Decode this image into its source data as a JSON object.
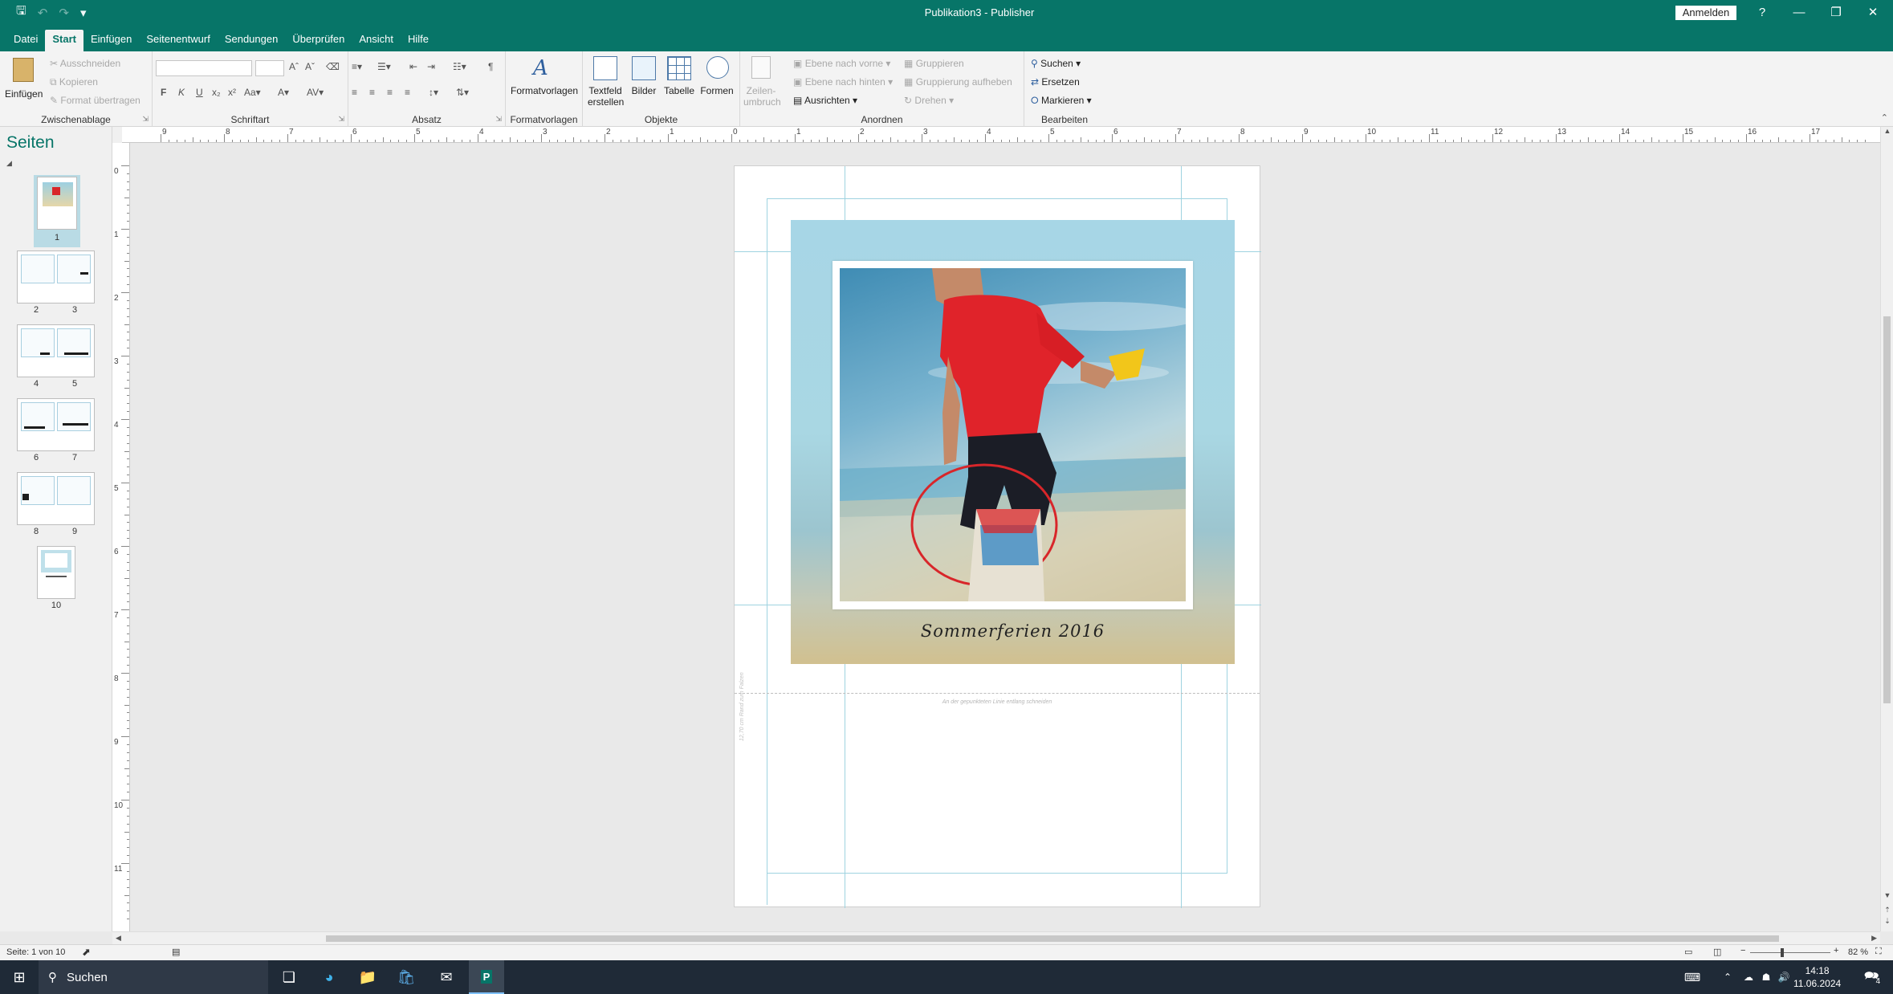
{
  "titlebar": {
    "title": "Publikation3  -  Publisher",
    "signin": "Anmelden",
    "help": "?"
  },
  "menu": {
    "tabs": [
      "Datei",
      "Start",
      "Einfügen",
      "Seitenentwurf",
      "Sendungen",
      "Überprüfen",
      "Ansicht",
      "Hilfe"
    ],
    "active": "Start"
  },
  "ribbon": {
    "clipboard": {
      "paste": "Einfügen",
      "cut": "Ausschneiden",
      "copy": "Kopieren",
      "format_painter": "Format übertragen",
      "label": "Zwischenablage"
    },
    "font": {
      "label": "Schriftart",
      "bold": "F",
      "italic": "K",
      "underline": "U"
    },
    "paragraph": {
      "label": "Absatz"
    },
    "styles": {
      "button": "Formatvorlagen",
      "label": "Formatvorlagen"
    },
    "objects": {
      "textbox_line1": "Textfeld",
      "textbox_line2": "erstellen",
      "pictures": "Bilder",
      "table": "Tabelle",
      "shapes": "Formen",
      "label": "Objekte"
    },
    "arrange": {
      "wrap_line1": "Zeilen-",
      "wrap_line2": "umbruch",
      "bring_forward": "Ebene nach vorne",
      "send_backward": "Ebene nach hinten",
      "align": "Ausrichten",
      "group": "Gruppieren",
      "ungroup": "Gruppierung aufheben",
      "rotate": "Drehen",
      "label": "Anordnen"
    },
    "editing": {
      "find": "Suchen",
      "replace": "Ersetzen",
      "select": "Markieren",
      "label": "Bearbeiten"
    }
  },
  "pages_pane": {
    "title": "Seiten",
    "pages": [
      "1",
      "2",
      "3",
      "4",
      "5",
      "6",
      "7",
      "8",
      "9",
      "10"
    ]
  },
  "rulers": {
    "horizontal": [
      "9",
      "8",
      "7",
      "6",
      "5",
      "4",
      "3",
      "2",
      "1",
      "0",
      "1",
      "2",
      "3",
      "4",
      "5",
      "6",
      "7",
      "8",
      "9",
      "10",
      "11",
      "12",
      "13",
      "14",
      "15",
      "16",
      "17"
    ],
    "vertical": [
      "0",
      "1",
      "2",
      "3",
      "4",
      "5",
      "6",
      "7",
      "8",
      "9",
      "10",
      "11"
    ]
  },
  "document": {
    "caption": "Sommerferien 2016",
    "cut_hint": "An der gepunkteten Linie entlang schneiden",
    "side_note": "12,70 cm Rand zum Falzen"
  },
  "status": {
    "page_info": "Seite: 1 von 10",
    "zoom": "82 %"
  },
  "taskbar": {
    "search": "Suchen",
    "time": "14:18",
    "date": "11.06.2024",
    "notification_count": "4"
  }
}
